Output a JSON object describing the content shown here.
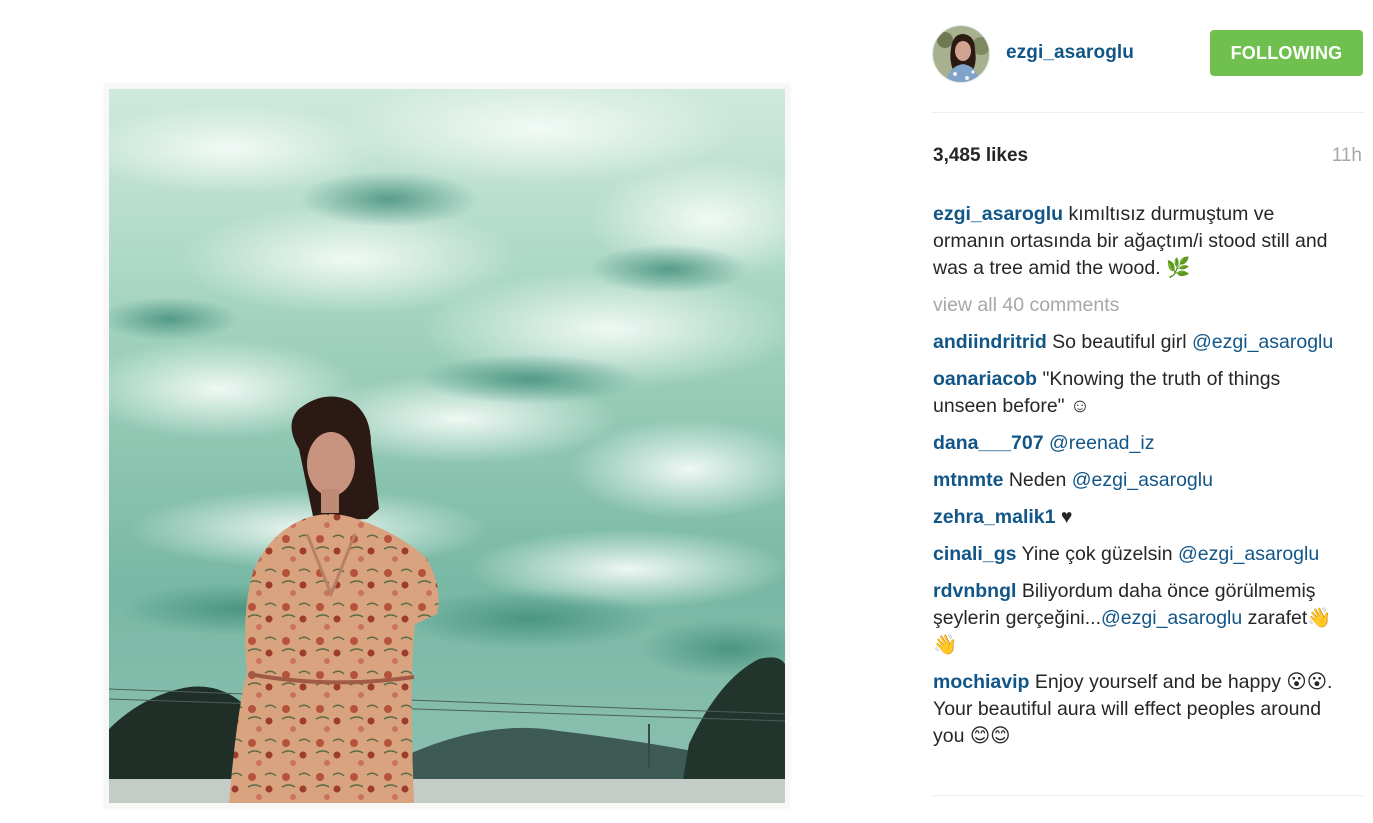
{
  "post": {
    "username": "ezgi_asaroglu",
    "follow_label": "FOLLOWING",
    "likes": "3,485 likes",
    "time": "11h",
    "caption": {
      "author": "ezgi_asaroglu",
      "text": " kımıltısız durmuştum ve ormanın ortasında bir ağaçtım/i stood still and was a tree amid the wood. 🌿"
    },
    "view_all": "view all 40 comments"
  },
  "comments": [
    {
      "author": "andiindritrid",
      "text": " So beautiful girl ",
      "mention": "@ezgi_asaroglu",
      "tail": ""
    },
    {
      "author": "oanariacob",
      "text": " \"Knowing the truth of things unseen before\" ☺",
      "mention": "",
      "tail": ""
    },
    {
      "author": "dana___707",
      "text": " ",
      "mention": "@reenad_iz",
      "tail": ""
    },
    {
      "author": "mtnmte",
      "text": " Neden ",
      "mention": "@ezgi_asaroglu",
      "tail": ""
    },
    {
      "author": "zehra_malik1",
      "text": " ♥",
      "mention": "",
      "tail": ""
    },
    {
      "author": "cinali_gs",
      "text": " Yine çok güzelsin ",
      "mention": "@ezgi_asaroglu",
      "tail": ""
    },
    {
      "author": "rdvnbngl",
      "text": " Biliyordum daha önce görülmemiş şeylerin gerçeğini...",
      "mention": "@ezgi_asaroglu",
      "tail": " zarafet👋👋"
    },
    {
      "author": "mochiavip",
      "text": " Enjoy yourself and be happy 😮😮. Your beautiful aura will effect peoples around you 😊😊",
      "mention": "",
      "tail": ""
    }
  ],
  "colors": {
    "link": "#125688",
    "follow_bg": "#70c050",
    "muted": "#a5a7aa"
  }
}
